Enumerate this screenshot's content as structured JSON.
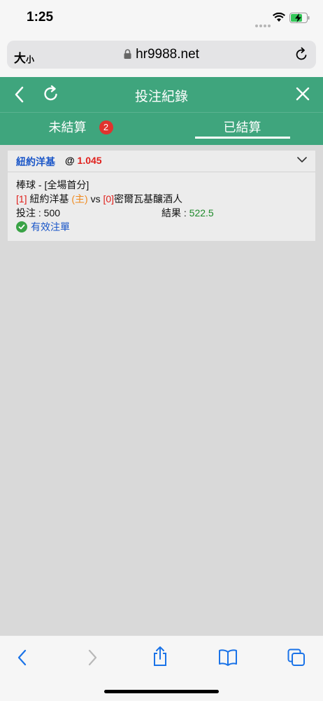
{
  "status": {
    "time": "1:25"
  },
  "browser": {
    "text_size_label": "大",
    "text_size_small": "小",
    "url": "hr9988.net"
  },
  "header": {
    "title": "投注紀錄"
  },
  "tabs": [
    {
      "label": "未結算",
      "badge": "2"
    },
    {
      "label": "已結算"
    }
  ],
  "bet": {
    "team": "紐約洋基",
    "at": "@",
    "odds": "1.045",
    "market": "棒球 - [全場首分]",
    "home_score": "[1]",
    "home_team": "紐約洋基",
    "home_tag": "(主)",
    "vs": "vs",
    "away_score": "[0]",
    "away_team": "密爾瓦基釀酒人",
    "stake_label": "投注 : ",
    "stake_value": "500",
    "result_label": "結果 : ",
    "result_value": "522.5",
    "status": "有效注單"
  },
  "colors": {
    "accent": "#3fa57d",
    "badge": "#e0332e",
    "odds": "#e0201c",
    "team": "#1a56c8",
    "result": "#1e8a2a",
    "home_tag": "#f08a1e"
  },
  "icons": [
    "back-icon",
    "refresh-icon",
    "close-icon",
    "chevron-down-icon",
    "check-circle-icon",
    "lock-icon",
    "reload-icon",
    "share-icon",
    "bookmarks-icon",
    "tabs-icon",
    "forward-icon"
  ]
}
